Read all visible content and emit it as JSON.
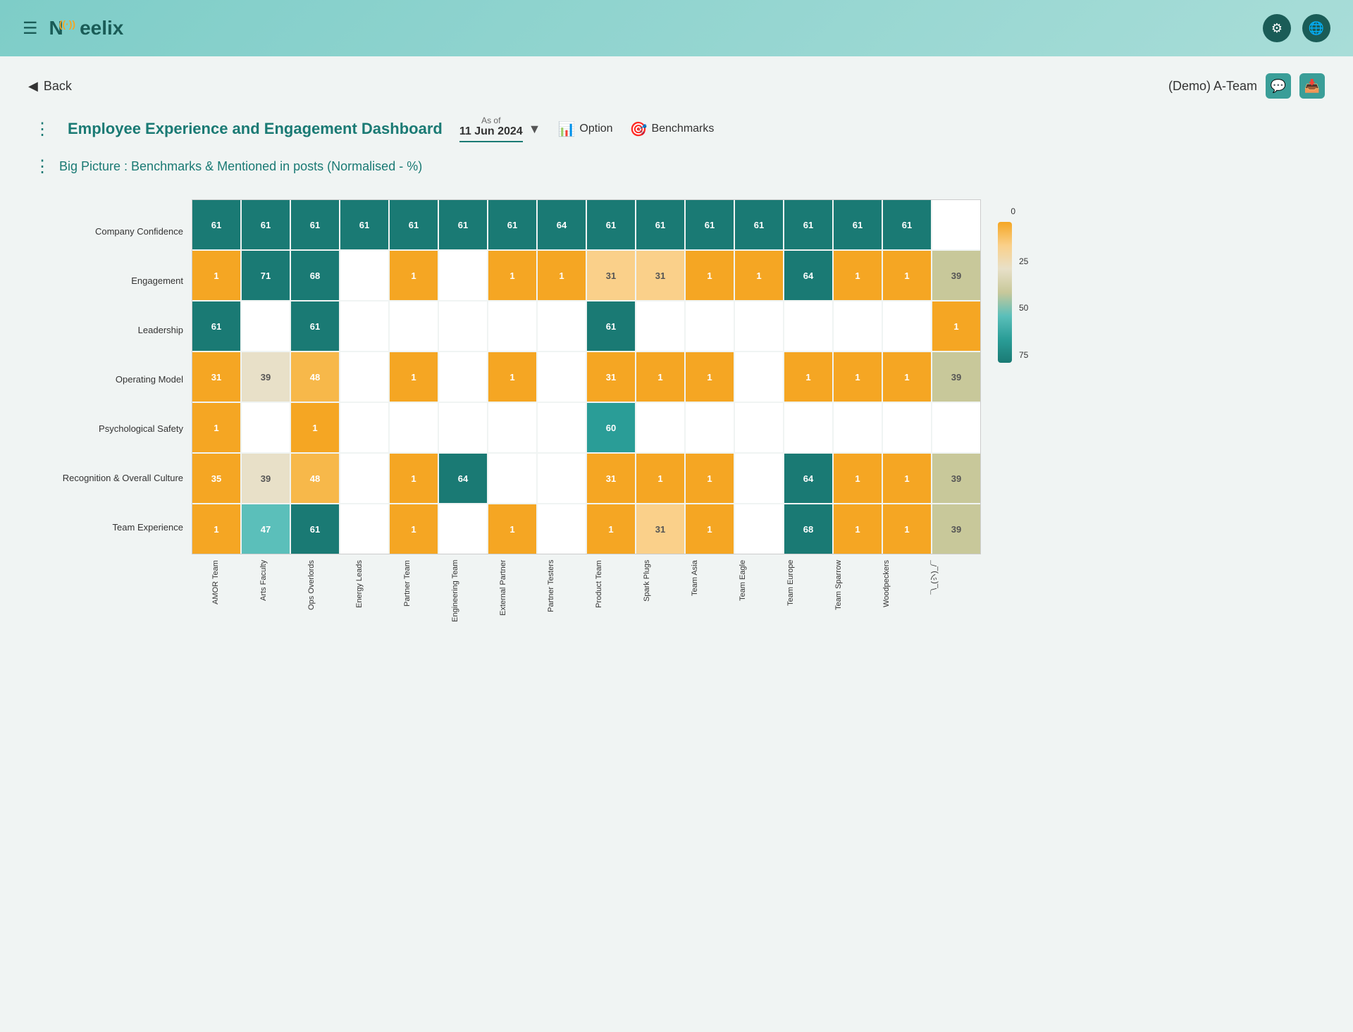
{
  "header": {
    "hamburger_icon": "☰",
    "logo": "Neelix",
    "wifi_symbol": "((·))",
    "gear_icon": "⚙",
    "globe_icon": "🌐"
  },
  "nav": {
    "back_label": "Back",
    "team_label": "(Demo) A-Team",
    "chat_icon": "💬",
    "download_icon": "📥"
  },
  "dashboard": {
    "title": "Employee Experience and Engagement Dashboard",
    "as_of_label": "As of",
    "date_value": "11 Jun 2024",
    "option_label": "Option",
    "benchmarks_label": "Benchmarks",
    "sub_title": "Big Picture : Benchmarks & Mentioned in posts (Normalised - %)"
  },
  "heatmap": {
    "row_labels": [
      "Company Confidence",
      "Engagement",
      "Leadership",
      "Operating Model",
      "Psychological Safety",
      "Recognition & Overall Culture",
      "Team Experience"
    ],
    "col_labels": [
      "AMOR Team",
      "Arts Faculty",
      "Ops Overlords",
      "Energy Leads",
      "Partner Team",
      "Engineering Team",
      "External Partner",
      "Partner Testers",
      "Product Team",
      "Spark Plugs",
      "Team Asia",
      "Team Eagle",
      "Team Europe",
      "Team Sparrow",
      "Woodpeckers",
      "¯\\_(ツ)_/¯"
    ],
    "legend_ticks": [
      "0",
      "25",
      "50",
      "75"
    ],
    "rows": [
      {
        "label": "Company Confidence",
        "cells": [
          {
            "value": "61",
            "color": "teal-dark"
          },
          {
            "value": "61",
            "color": "teal-dark"
          },
          {
            "value": "61",
            "color": "teal-dark"
          },
          {
            "value": "61",
            "color": "teal-dark"
          },
          {
            "value": "61",
            "color": "teal-dark"
          },
          {
            "value": "61",
            "color": "teal-dark"
          },
          {
            "value": "61",
            "color": "teal-dark"
          },
          {
            "value": "64",
            "color": "teal-dark"
          },
          {
            "value": "61",
            "color": "teal-dark"
          },
          {
            "value": "61",
            "color": "teal-dark"
          },
          {
            "value": "61",
            "color": "teal-dark"
          },
          {
            "value": "61",
            "color": "teal-dark"
          },
          {
            "value": "61",
            "color": "teal-dark"
          },
          {
            "value": "61",
            "color": "teal-dark"
          },
          {
            "value": "61",
            "color": "teal-dark"
          },
          {
            "value": "",
            "color": "white"
          }
        ]
      },
      {
        "label": "Engagement",
        "cells": [
          {
            "value": "1",
            "color": "orange-dark"
          },
          {
            "value": "71",
            "color": "teal-dark"
          },
          {
            "value": "68",
            "color": "teal-dark"
          },
          {
            "value": "",
            "color": "white"
          },
          {
            "value": "1",
            "color": "orange-dark"
          },
          {
            "value": "",
            "color": "white"
          },
          {
            "value": "1",
            "color": "orange-dark"
          },
          {
            "value": "1",
            "color": "orange-dark"
          },
          {
            "value": "31",
            "color": "orange-light"
          },
          {
            "value": "31",
            "color": "orange-light"
          },
          {
            "value": "1",
            "color": "orange-dark"
          },
          {
            "value": "1",
            "color": "orange-dark"
          },
          {
            "value": "64",
            "color": "teal-dark"
          },
          {
            "value": "1",
            "color": "orange-dark"
          },
          {
            "value": "1",
            "color": "orange-dark"
          },
          {
            "value": "39",
            "color": "khaki"
          }
        ]
      },
      {
        "label": "Leadership",
        "cells": [
          {
            "value": "61",
            "color": "teal-dark"
          },
          {
            "value": "",
            "color": "white"
          },
          {
            "value": "61",
            "color": "teal-dark"
          },
          {
            "value": "",
            "color": "white"
          },
          {
            "value": "",
            "color": "white"
          },
          {
            "value": "",
            "color": "white"
          },
          {
            "value": "",
            "color": "white"
          },
          {
            "value": "",
            "color": "white"
          },
          {
            "value": "61",
            "color": "teal-dark"
          },
          {
            "value": "",
            "color": "white"
          },
          {
            "value": "",
            "color": "white"
          },
          {
            "value": "",
            "color": "white"
          },
          {
            "value": "",
            "color": "white"
          },
          {
            "value": "",
            "color": "white"
          },
          {
            "value": "",
            "color": "white"
          },
          {
            "value": "1",
            "color": "orange-dark"
          }
        ]
      },
      {
        "label": "Operating Model",
        "cells": [
          {
            "value": "31",
            "color": "orange-dark"
          },
          {
            "value": "39",
            "color": "cream"
          },
          {
            "value": "48",
            "color": "orange-med"
          },
          {
            "value": "",
            "color": "white"
          },
          {
            "value": "1",
            "color": "orange-dark"
          },
          {
            "value": "",
            "color": "white"
          },
          {
            "value": "1",
            "color": "orange-dark"
          },
          {
            "value": "",
            "color": "white"
          },
          {
            "value": "31",
            "color": "orange-dark"
          },
          {
            "value": "1",
            "color": "orange-dark"
          },
          {
            "value": "1",
            "color": "orange-dark"
          },
          {
            "value": "",
            "color": "white"
          },
          {
            "value": "1",
            "color": "orange-dark"
          },
          {
            "value": "1",
            "color": "orange-dark"
          },
          {
            "value": "1",
            "color": "orange-dark"
          },
          {
            "value": "39",
            "color": "khaki"
          }
        ]
      },
      {
        "label": "Psychological Safety",
        "cells": [
          {
            "value": "1",
            "color": "orange-dark"
          },
          {
            "value": "",
            "color": "white"
          },
          {
            "value": "1",
            "color": "orange-dark"
          },
          {
            "value": "",
            "color": "white"
          },
          {
            "value": "",
            "color": "white"
          },
          {
            "value": "",
            "color": "white"
          },
          {
            "value": "",
            "color": "white"
          },
          {
            "value": "",
            "color": "white"
          },
          {
            "value": "60",
            "color": "teal-med"
          },
          {
            "value": "",
            "color": "white"
          },
          {
            "value": "",
            "color": "white"
          },
          {
            "value": "",
            "color": "white"
          },
          {
            "value": "",
            "color": "white"
          },
          {
            "value": "",
            "color": "white"
          },
          {
            "value": "",
            "color": "white"
          },
          {
            "value": "",
            "color": "white"
          }
        ]
      },
      {
        "label": "Recognition & Overall Culture",
        "cells": [
          {
            "value": "35",
            "color": "orange-dark"
          },
          {
            "value": "39",
            "color": "cream"
          },
          {
            "value": "48",
            "color": "orange-med"
          },
          {
            "value": "",
            "color": "white"
          },
          {
            "value": "1",
            "color": "orange-dark"
          },
          {
            "value": "64",
            "color": "teal-dark"
          },
          {
            "value": "",
            "color": "white"
          },
          {
            "value": "",
            "color": "white"
          },
          {
            "value": "31",
            "color": "orange-dark"
          },
          {
            "value": "1",
            "color": "orange-dark"
          },
          {
            "value": "1",
            "color": "orange-dark"
          },
          {
            "value": "",
            "color": "white"
          },
          {
            "value": "64",
            "color": "teal-dark"
          },
          {
            "value": "1",
            "color": "orange-dark"
          },
          {
            "value": "1",
            "color": "orange-dark"
          },
          {
            "value": "39",
            "color": "khaki"
          }
        ]
      },
      {
        "label": "Team Experience",
        "cells": [
          {
            "value": "1",
            "color": "orange-dark"
          },
          {
            "value": "47",
            "color": "teal-light"
          },
          {
            "value": "61",
            "color": "teal-dark"
          },
          {
            "value": "",
            "color": "white"
          },
          {
            "value": "1",
            "color": "orange-dark"
          },
          {
            "value": "",
            "color": "white"
          },
          {
            "value": "1",
            "color": "orange-dark"
          },
          {
            "value": "",
            "color": "white"
          },
          {
            "value": "1",
            "color": "orange-dark"
          },
          {
            "value": "31",
            "color": "orange-light"
          },
          {
            "value": "1",
            "color": "orange-dark"
          },
          {
            "value": "",
            "color": "white"
          },
          {
            "value": "68",
            "color": "teal-dark"
          },
          {
            "value": "1",
            "color": "orange-dark"
          },
          {
            "value": "1",
            "color": "orange-dark"
          },
          {
            "value": "39",
            "color": "khaki"
          }
        ]
      }
    ]
  }
}
